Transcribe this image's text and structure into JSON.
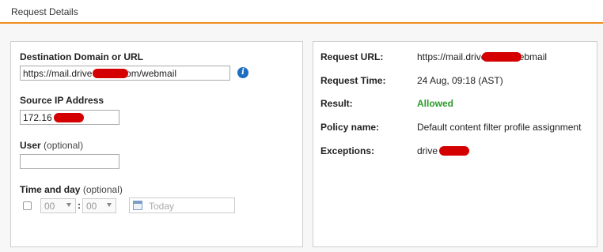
{
  "header": {
    "title": "Request Details"
  },
  "form": {
    "destination_label": "Destination Domain or URL",
    "destination_value": "https://mail.drive          .com/webmail",
    "source_ip_label": "Source IP Address",
    "source_ip_value": "172.16",
    "user_label": "User",
    "user_optional": "(optional)",
    "user_value": "",
    "time_label": "Time and day",
    "time_optional": "(optional)",
    "hour_value": "00",
    "minute_value": "00",
    "time_separator": ":",
    "date_placeholder": "Today"
  },
  "details": {
    "request_url_label": "Request URL:",
    "request_url_value": "https://mail.drive          .com/webmail",
    "request_time_label": "Request Time:",
    "request_time_value": "24 Aug, 09:18 (AST)",
    "result_label": "Result:",
    "result_value": "Allowed",
    "policy_label": "Policy name:",
    "policy_value": "Default content filter profile assignment",
    "exceptions_label": "Exceptions:",
    "exceptions_value": "drive"
  },
  "colors": {
    "accent": "#f08c1e",
    "allowed": "#2a9a2a",
    "info": "#1e6fc1",
    "redaction": "#d40000"
  },
  "icons": [
    "info-icon",
    "calendar-icon",
    "chevron-down-icon"
  ]
}
